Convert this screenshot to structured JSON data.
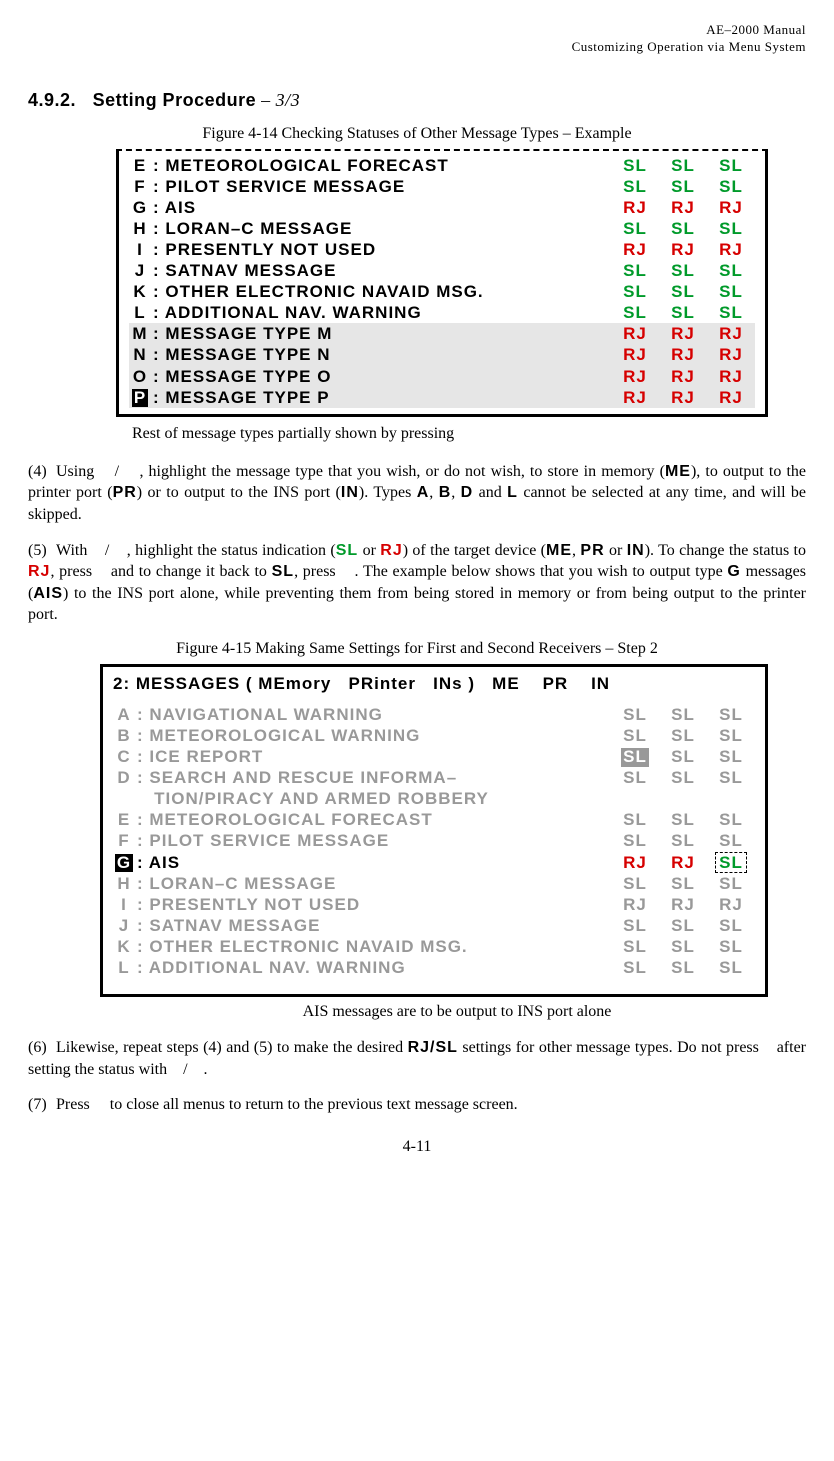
{
  "header": {
    "line1": "AE–2000 Manual",
    "line2": "Customizing Operation via Menu System"
  },
  "section": {
    "number": "4.9.2.",
    "title": "Setting Procedure",
    "suffix": " – 3/3"
  },
  "figure1": {
    "caption": "Figure 4-14   Checking Statuses of Other Message Types – Example",
    "rows": [
      {
        "key": "E",
        "name": "METEOROLOGICAL FORECAST",
        "s1": "SL",
        "s2": "SL",
        "s3": "SL",
        "cls": "sl",
        "shaded": false
      },
      {
        "key": "F",
        "name": "PILOT SERVICE MESSAGE",
        "s1": "SL",
        "s2": "SL",
        "s3": "SL",
        "cls": "sl",
        "shaded": false
      },
      {
        "key": "G",
        "name": "AIS",
        "s1": "RJ",
        "s2": "RJ",
        "s3": "RJ",
        "cls": "rj",
        "shaded": false
      },
      {
        "key": "H",
        "name": "LORAN–C MESSAGE",
        "s1": "SL",
        "s2": "SL",
        "s3": "SL",
        "cls": "sl",
        "shaded": false
      },
      {
        "key": " I",
        "name": "PRESENTLY NOT USED",
        "s1": "RJ",
        "s2": "RJ",
        "s3": "RJ",
        "cls": "rj",
        "shaded": false
      },
      {
        "key": "J",
        "name": "SATNAV MESSAGE",
        "s1": "SL",
        "s2": "SL",
        "s3": "SL",
        "cls": "sl",
        "shaded": false
      },
      {
        "key": "K",
        "name": "OTHER ELECTRONIC NAVAID MSG.",
        "s1": "SL",
        "s2": "SL",
        "s3": "SL",
        "cls": "sl",
        "shaded": false
      },
      {
        "key": "L",
        "name": "ADDITIONAL NAV. WARNING",
        "s1": "SL",
        "s2": "SL",
        "s3": "SL",
        "cls": "sl",
        "shaded": false
      },
      {
        "key": "M",
        "name": "MESSAGE TYPE M",
        "s1": "RJ",
        "s2": "RJ",
        "s3": "RJ",
        "cls": "rj",
        "shaded": true
      },
      {
        "key": "N",
        "name": "MESSAGE TYPE N",
        "s1": "RJ",
        "s2": "RJ",
        "s3": "RJ",
        "cls": "rj",
        "shaded": true
      },
      {
        "key": "O",
        "name": "MESSAGE TYPE O",
        "s1": "RJ",
        "s2": "RJ",
        "s3": "RJ",
        "cls": "rj",
        "shaded": true
      },
      {
        "key": "P",
        "name": "MESSAGE TYPE P",
        "s1": "RJ",
        "s2": "RJ",
        "s3": "RJ",
        "cls": "rj",
        "shaded": true,
        "cursor": true
      }
    ],
    "annotation": "Rest of message types partially shown by pressing"
  },
  "para4": {
    "num": "(4)",
    "t1": "Using ",
    "t2": " / ",
    "t3": " , highlight the message type that you wish, or do not wish, to store in memory (",
    "b1": "ME",
    "t4": "), to output to the printer port (",
    "b2": "PR",
    "t5": ") or to output to the INS port (",
    "b3": "IN",
    "t6": "). Types ",
    "b4": "A",
    "t7": ", ",
    "b5": "B",
    "t8": ", ",
    "b6": "D",
    "t9": " and ",
    "b7": "L",
    "t10": " cannot be selected at any time, and will be skipped."
  },
  "para5": {
    "num": "(5)",
    "t1": "With ",
    "t2": " / ",
    "t3": " , highlight the status indication (",
    "b1": "SL",
    "t4": " or ",
    "b2": "RJ",
    "t5": ") of the target device (",
    "b3": "ME",
    "t6": ", ",
    "b4": "PR",
    "t7": " or ",
    "b5": "IN",
    "t8": "). To change the status to ",
    "b6": "RJ",
    "t9": ", press ",
    "t10": " and to change it back to ",
    "b7": "SL",
    "t11": ", press ",
    "t12": " . The example below shows that you wish to output type ",
    "b8": "G",
    "t13": " messages (",
    "b9": "AIS",
    "t14": ") to the INS port alone, while preventing them from being stored in memory or from being output to the printer port."
  },
  "figure2": {
    "caption": "Figure 4-15   Making Same Settings for First and Second Receivers – Step 2",
    "title": "2: MESSAGES ( MEmory   PRinter   INs )   ME    PR    IN",
    "rows": [
      {
        "key": "A",
        "name": "NAVIGATIONAL WARNING",
        "s1": "SL",
        "s2": "SL",
        "s3": "SL",
        "grey": true
      },
      {
        "key": "B",
        "name": "METEOROLOGICAL WARNING",
        "s1": "SL",
        "s2": "SL",
        "s3": "SL",
        "grey": true
      },
      {
        "key": "C",
        "name": "ICE REPORT",
        "s1": "SL",
        "s2": "SL",
        "s3": "SL",
        "grey": true,
        "s1box": true
      },
      {
        "key": "D",
        "name": "SEARCH AND RESCUE INFORMA–",
        "s1": "SL",
        "s2": "SL",
        "s3": "SL",
        "grey": true
      },
      {
        "key": "",
        "name": "   TION/PIRACY AND ARMED ROBBERY",
        "s1": "",
        "s2": "",
        "s3": "",
        "grey": true,
        "cont": true
      },
      {
        "key": "E",
        "name": "METEOROLOGICAL FORECAST",
        "s1": "SL",
        "s2": "SL",
        "s3": "SL",
        "grey": true
      },
      {
        "key": "F",
        "name": "PILOT SERVICE MESSAGE",
        "s1": "SL",
        "s2": "SL",
        "s3": "SL",
        "grey": true
      },
      {
        "key": "G",
        "name": "AIS",
        "s1": "RJ",
        "s2": "RJ",
        "s3": "SL",
        "special": true
      },
      {
        "key": "H",
        "name": "LORAN–C MESSAGE",
        "s1": "SL",
        "s2": "SL",
        "s3": "SL",
        "grey": true
      },
      {
        "key": " I",
        "name": "PRESENTLY NOT USED",
        "s1": "RJ",
        "s2": "RJ",
        "s3": "RJ",
        "grey": true
      },
      {
        "key": "J",
        "name": "SATNAV MESSAGE",
        "s1": "SL",
        "s2": "SL",
        "s3": "SL",
        "grey": true
      },
      {
        "key": "K",
        "name": "OTHER ELECTRONIC NAVAID MSG.",
        "s1": "SL",
        "s2": "SL",
        "s3": "SL",
        "grey": true
      },
      {
        "key": "L",
        "name": "ADDITIONAL NAV. WARNING",
        "s1": "SL",
        "s2": "SL",
        "s3": "SL",
        "grey": true
      }
    ],
    "annotation": "AIS messages are to be output to INS port alone"
  },
  "para6": {
    "num": "(6)",
    "t1": "Likewise, repeat steps (4) and (5) to make the desired ",
    "b1": "RJ/SL",
    "t2": " settings for other message types. Do not press ",
    "t3": " after setting the status with ",
    "t4": " / ",
    "t5": " ."
  },
  "para7": {
    "num": "(7)",
    "t1": "Press ",
    "t2": " to close all menus to return to the previous text message screen."
  },
  "pageNumber": "4-11"
}
